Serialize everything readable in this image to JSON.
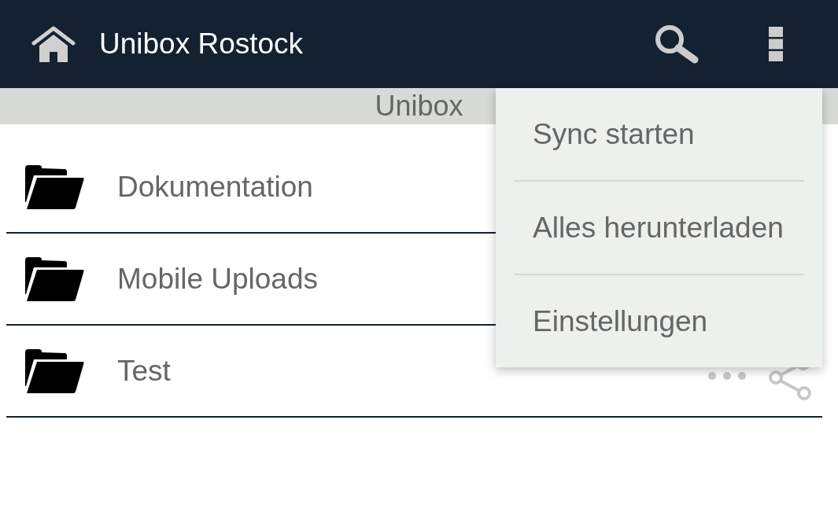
{
  "app_bar": {
    "title": "Unibox Rostock"
  },
  "breadcrumb": {
    "label": "Unibox"
  },
  "folders": [
    {
      "name": "Dokumentation"
    },
    {
      "name": "Mobile Uploads"
    },
    {
      "name": "Test",
      "actions": [
        {
          "kind": "more"
        },
        {
          "kind": "share"
        }
      ]
    }
  ],
  "overflow_menu": {
    "open": true,
    "items": [
      "Sync starten",
      "Alles herunterladen",
      "Einstellungen"
    ]
  }
}
